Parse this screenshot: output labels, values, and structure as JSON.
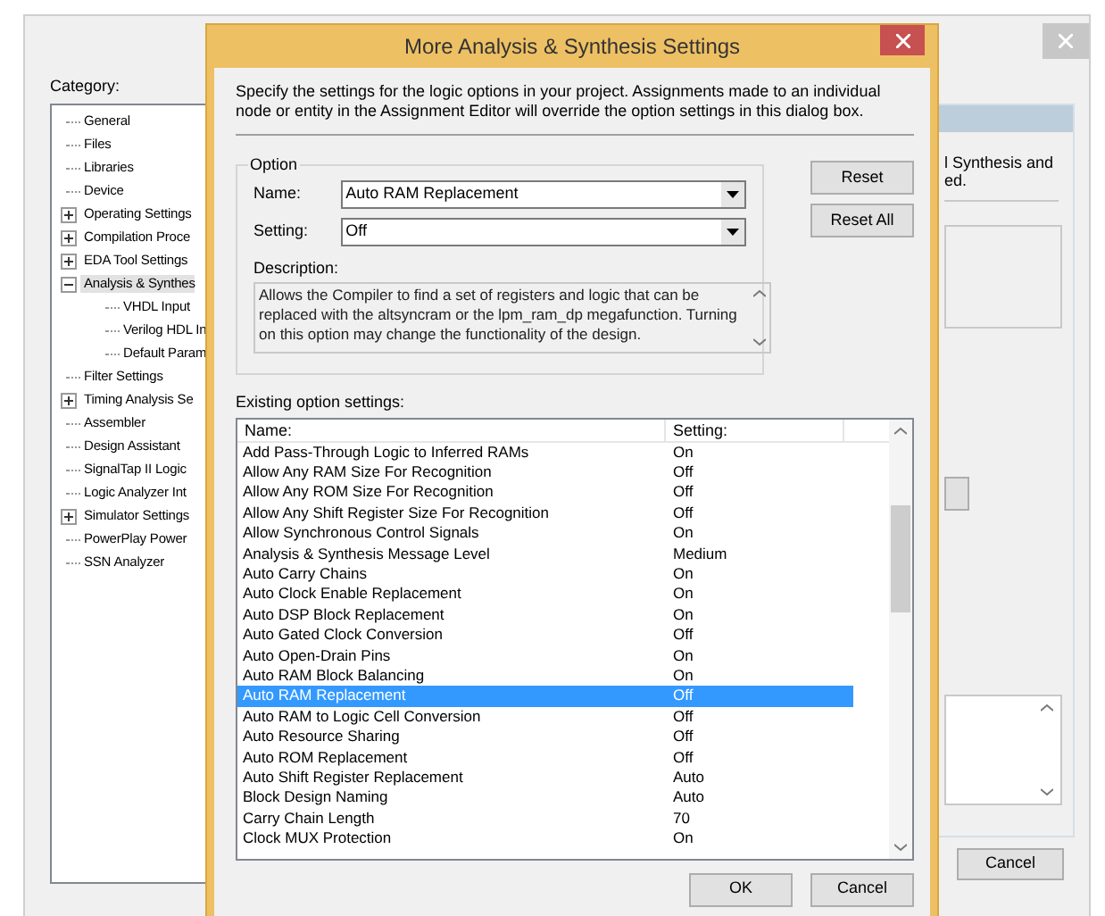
{
  "background_window": {
    "category_label": "Category:",
    "tree": [
      {
        "label": "General",
        "selected": false
      },
      {
        "label": "Files",
        "selected": false
      },
      {
        "label": "Libraries",
        "selected": false
      },
      {
        "label": "Device",
        "selected": false
      },
      {
        "label": "Operating Settings",
        "expanded": false,
        "selected": false
      },
      {
        "label": "Compilation Proce",
        "expanded": false,
        "selected": false
      },
      {
        "label": "EDA Tool Settings",
        "expanded": false,
        "selected": false
      },
      {
        "label": "Analysis & Synthes",
        "expanded": true,
        "selected": true,
        "children": [
          {
            "label": "VHDL Input",
            "selected": false
          },
          {
            "label": "Verilog HDL In",
            "selected": false
          },
          {
            "label": "Default Param",
            "selected": false
          }
        ]
      },
      {
        "label": "Filter Settings",
        "selected": false
      },
      {
        "label": "Timing Analysis Se",
        "expanded": false,
        "selected": false
      },
      {
        "label": "Assembler",
        "selected": false
      },
      {
        "label": "Design Assistant",
        "selected": false
      },
      {
        "label": "SignalTap II Logic",
        "selected": false
      },
      {
        "label": "Logic Analyzer Int",
        "selected": false
      },
      {
        "label": "Simulator Settings",
        "expanded": false,
        "selected": false
      },
      {
        "label": "PowerPlay Power",
        "selected": false
      },
      {
        "label": "SSN Analyzer",
        "selected": false
      }
    ],
    "panel_text": [
      "l Synthesis and",
      "ed."
    ],
    "cancel_button": "Cancel"
  },
  "dialog": {
    "title": "More Analysis & Synthesis Settings",
    "intro": "Specify the settings for the logic options in your project.  Assignments made to an individual node or entity in the Assignment Editor will override the option settings in this dialog box.",
    "option_group": "Option",
    "name_label": "Name:",
    "name_value": "Auto RAM Replacement",
    "setting_label": "Setting:",
    "setting_value": "Off",
    "description_label": "Description:",
    "description": "Allows the Compiler to find a set of registers and logic that can be replaced with the altsyncram or the lpm_ram_dp megafunction. Turning on this option may change the functionality of the design.",
    "buttons": [
      "Reset",
      "Reset All"
    ],
    "existing_label": "Existing option settings:",
    "table": {
      "columns": [
        "Name:",
        "Setting:"
      ],
      "rows": [
        {
          "name": "Add Pass-Through Logic to Inferred RAMs",
          "setting": "On",
          "selected": false
        },
        {
          "name": "Allow Any RAM Size For Recognition",
          "setting": "Off",
          "selected": false
        },
        {
          "name": "Allow Any ROM Size For Recognition",
          "setting": "Off",
          "selected": false
        },
        {
          "name": "Allow Any Shift Register Size For Recognition",
          "setting": "Off",
          "selected": false
        },
        {
          "name": "Allow Synchronous Control Signals",
          "setting": "On",
          "selected": false
        },
        {
          "name": "Analysis & Synthesis Message Level",
          "setting": "Medium",
          "selected": false
        },
        {
          "name": "Auto Carry Chains",
          "setting": "On",
          "selected": false
        },
        {
          "name": "Auto Clock Enable Replacement",
          "setting": "On",
          "selected": false
        },
        {
          "name": "Auto DSP Block Replacement",
          "setting": "On",
          "selected": false
        },
        {
          "name": "Auto Gated Clock Conversion",
          "setting": "Off",
          "selected": false
        },
        {
          "name": "Auto Open-Drain Pins",
          "setting": "On",
          "selected": false
        },
        {
          "name": "Auto RAM Block Balancing",
          "setting": "On",
          "selected": false
        },
        {
          "name": "Auto RAM Replacement",
          "setting": "Off",
          "selected": true
        },
        {
          "name": "Auto RAM to Logic Cell Conversion",
          "setting": "Off",
          "selected": false
        },
        {
          "name": "Auto Resource Sharing",
          "setting": "Off",
          "selected": false
        },
        {
          "name": "Auto ROM Replacement",
          "setting": "Off",
          "selected": false
        },
        {
          "name": "Auto Shift Register Replacement",
          "setting": "Auto",
          "selected": false
        },
        {
          "name": "Block Design Naming",
          "setting": "Auto",
          "selected": false
        },
        {
          "name": "Carry Chain Length",
          "setting": "70",
          "selected": false
        },
        {
          "name": "Clock MUX Protection",
          "setting": "On",
          "selected": false
        }
      ]
    },
    "footer_buttons": [
      "OK",
      "Cancel"
    ]
  }
}
